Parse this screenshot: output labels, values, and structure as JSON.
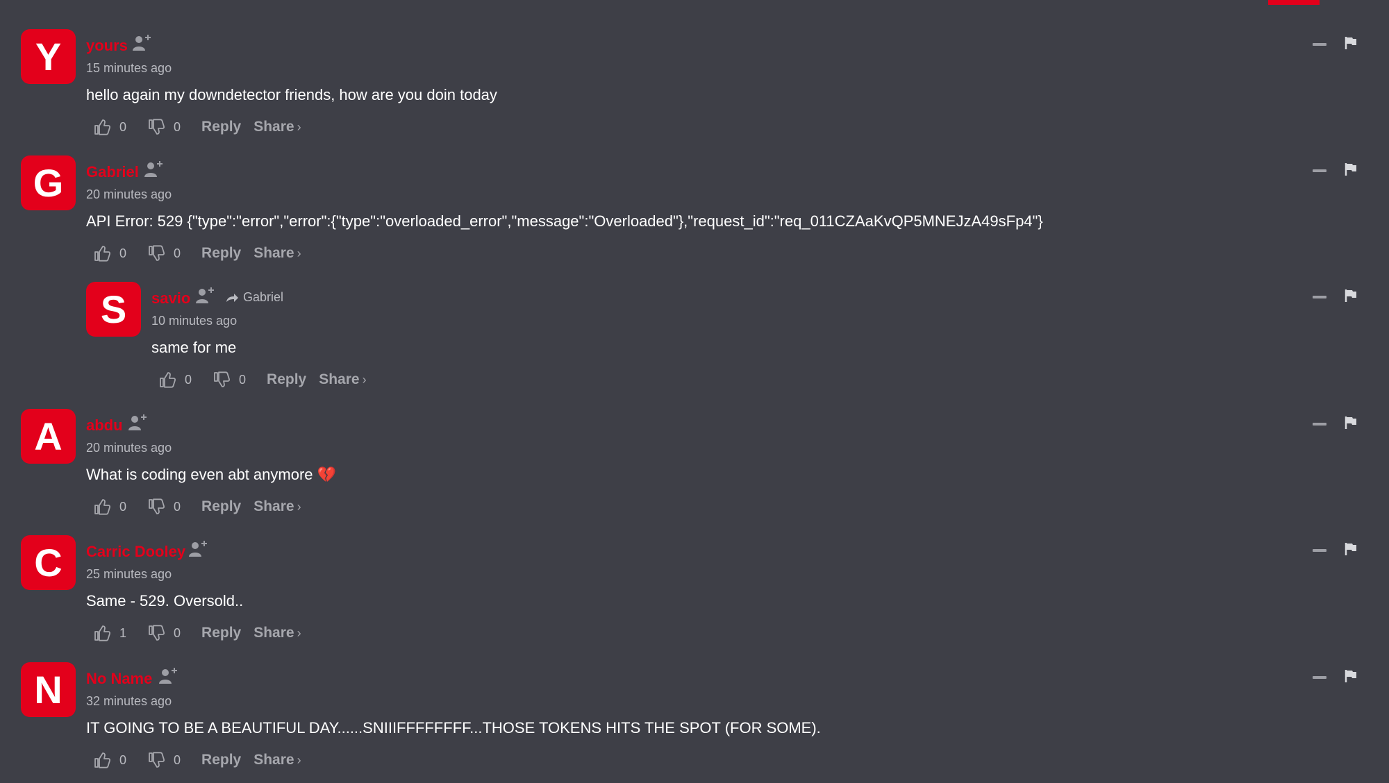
{
  "colors": {
    "background": "#3e3f47",
    "accent": "#e3001b",
    "muted_text": "#a6a7ad"
  },
  "icons": {
    "follow": "person-plus-icon",
    "like": "thumbs-up-icon",
    "dislike": "thumbs-down-icon",
    "collapse": "minus-icon",
    "flag": "flag-icon",
    "reply_arrow": "share-arrow-icon"
  },
  "labels": {
    "reply": "Reply",
    "share": "Share",
    "share_chevron": "›"
  },
  "comments": [
    {
      "initial": "Y",
      "author": "yours",
      "time": "15 minutes ago",
      "text": "hello again my downdetector friends, how are you doin today",
      "likes": "0",
      "dislikes": "0"
    },
    {
      "initial": "G",
      "author": "Gabriel",
      "time": "20 minutes ago",
      "text": "API Error: 529 {\"type\":\"error\",\"error\":{\"type\":\"overloaded_error\",\"message\":\"Overloaded\"},\"request_id\":\"req_011CZAaKvQP5MNEJzA49sFp4\"}",
      "likes": "0",
      "dislikes": "0"
    },
    {
      "initial": "S",
      "author": "savio",
      "reply_to": "Gabriel",
      "time": "10 minutes ago",
      "text": "same for me",
      "likes": "0",
      "dislikes": "0"
    },
    {
      "initial": "A",
      "author": "abdu",
      "time": "20 minutes ago",
      "text": "What is coding even abt anymore 💔",
      "likes": "0",
      "dislikes": "0"
    },
    {
      "initial": "C",
      "author": "Carric Dooley",
      "time": "25 minutes ago",
      "text": "Same - 529. Oversold..",
      "likes": "1",
      "dislikes": "0"
    },
    {
      "initial": "N",
      "author": "No Name",
      "time": "32 minutes ago",
      "text": "IT GOING TO BE A BEAUTIFUL DAY......SNIIIFFFFFFFF...THOSE TOKENS HITS THE SPOT (FOR SOME).",
      "likes": "0",
      "dislikes": "0"
    }
  ]
}
